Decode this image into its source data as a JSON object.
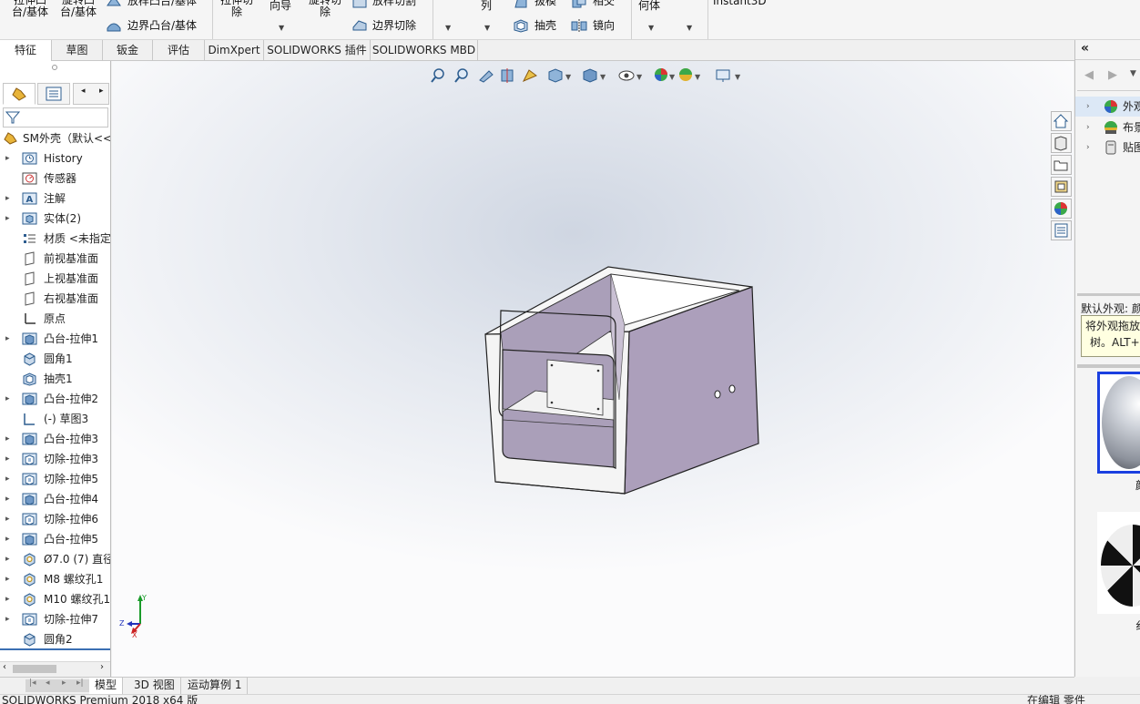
{
  "ribbon": {
    "extrude_boss": "拉伸凸\n台/基体",
    "revolve_boss": "旋转凸\n台/基体",
    "loft_boss": "放样凸台/基体",
    "boundary_boss": "边界凸台/基体",
    "extrude_cut": "拉伸切\n除",
    "hole_wizard": "向导",
    "revolve_cut": "旋转切\n除",
    "loft_cut": "放样切割",
    "boundary_cut": "边界切除",
    "pattern": "列",
    "draft": "拔模",
    "intersect": "相交",
    "shell": "抽壳",
    "mirror": "镜向",
    "ref_geometry": "何体",
    "instant3d": "Instant3D"
  },
  "tabs": [
    "特征",
    "草图",
    "钣金",
    "评估",
    "DimXpert",
    "SOLIDWORKS 插件",
    "SOLIDWORKS MBD"
  ],
  "active_tab": "特征",
  "tree": {
    "root": "SM外壳（默认<<",
    "nodes": [
      {
        "label": "History",
        "icon": "history-icon",
        "expand": true
      },
      {
        "label": "传感器",
        "icon": "sensor-icon",
        "expand": false
      },
      {
        "label": "注解",
        "icon": "annotation-icon",
        "expand": true
      },
      {
        "label": "实体(2)",
        "icon": "solid-bodies-icon",
        "expand": true
      },
      {
        "label": "材质 <未指定",
        "icon": "material-icon",
        "expand": false
      },
      {
        "label": "前视基准面",
        "icon": "plane-icon",
        "expand": false
      },
      {
        "label": "上视基准面",
        "icon": "plane-icon",
        "expand": false
      },
      {
        "label": "右视基准面",
        "icon": "plane-icon",
        "expand": false
      },
      {
        "label": "原点",
        "icon": "origin-icon",
        "expand": false
      },
      {
        "label": "凸台-拉伸1",
        "icon": "boss-extrude-icon",
        "expand": true
      },
      {
        "label": "圆角1",
        "icon": "fillet-icon",
        "expand": false
      },
      {
        "label": "抽壳1",
        "icon": "shell-icon",
        "expand": false
      },
      {
        "label": "凸台-拉伸2",
        "icon": "boss-extrude-icon",
        "expand": true
      },
      {
        "label": "(-) 草图3",
        "icon": "sketch-icon",
        "expand": false
      },
      {
        "label": "凸台-拉伸3",
        "icon": "boss-extrude-icon",
        "expand": true
      },
      {
        "label": "切除-拉伸3",
        "icon": "cut-extrude-icon",
        "expand": true
      },
      {
        "label": "切除-拉伸5",
        "icon": "cut-extrude-icon",
        "expand": true
      },
      {
        "label": "凸台-拉伸4",
        "icon": "boss-extrude-icon",
        "expand": true
      },
      {
        "label": "切除-拉伸6",
        "icon": "cut-extrude-icon",
        "expand": true
      },
      {
        "label": "凸台-拉伸5",
        "icon": "boss-extrude-icon",
        "expand": true
      },
      {
        "label": "Ø7.0 (7) 直径",
        "icon": "hole-icon",
        "expand": true
      },
      {
        "label": "M8 螺纹孔1",
        "icon": "hole-icon",
        "expand": true
      },
      {
        "label": "M10 螺纹孔1",
        "icon": "hole-icon",
        "expand": true
      },
      {
        "label": "切除-拉伸7",
        "icon": "cut-extrude-icon",
        "expand": true
      },
      {
        "label": "圆角2",
        "icon": "fillet-icon",
        "expand": false
      }
    ]
  },
  "triad": {
    "y": "Y",
    "z": "Z",
    "x": "X"
  },
  "right_pane": {
    "collapse": "«",
    "items": [
      "外观",
      "布景",
      "贴图"
    ],
    "default_appearance": "默认外观: 颜",
    "hint_line1": "将外观拖放",
    "hint_line2": "树。ALT+"
  },
  "bottom_tabs": [
    "模型",
    "3D 视图",
    "运动算例 1"
  ],
  "active_bottom_tab": "模型",
  "status": {
    "left": "SOLIDWORKS Premium 2018 x64 版",
    "right": "在编辑 零件"
  }
}
